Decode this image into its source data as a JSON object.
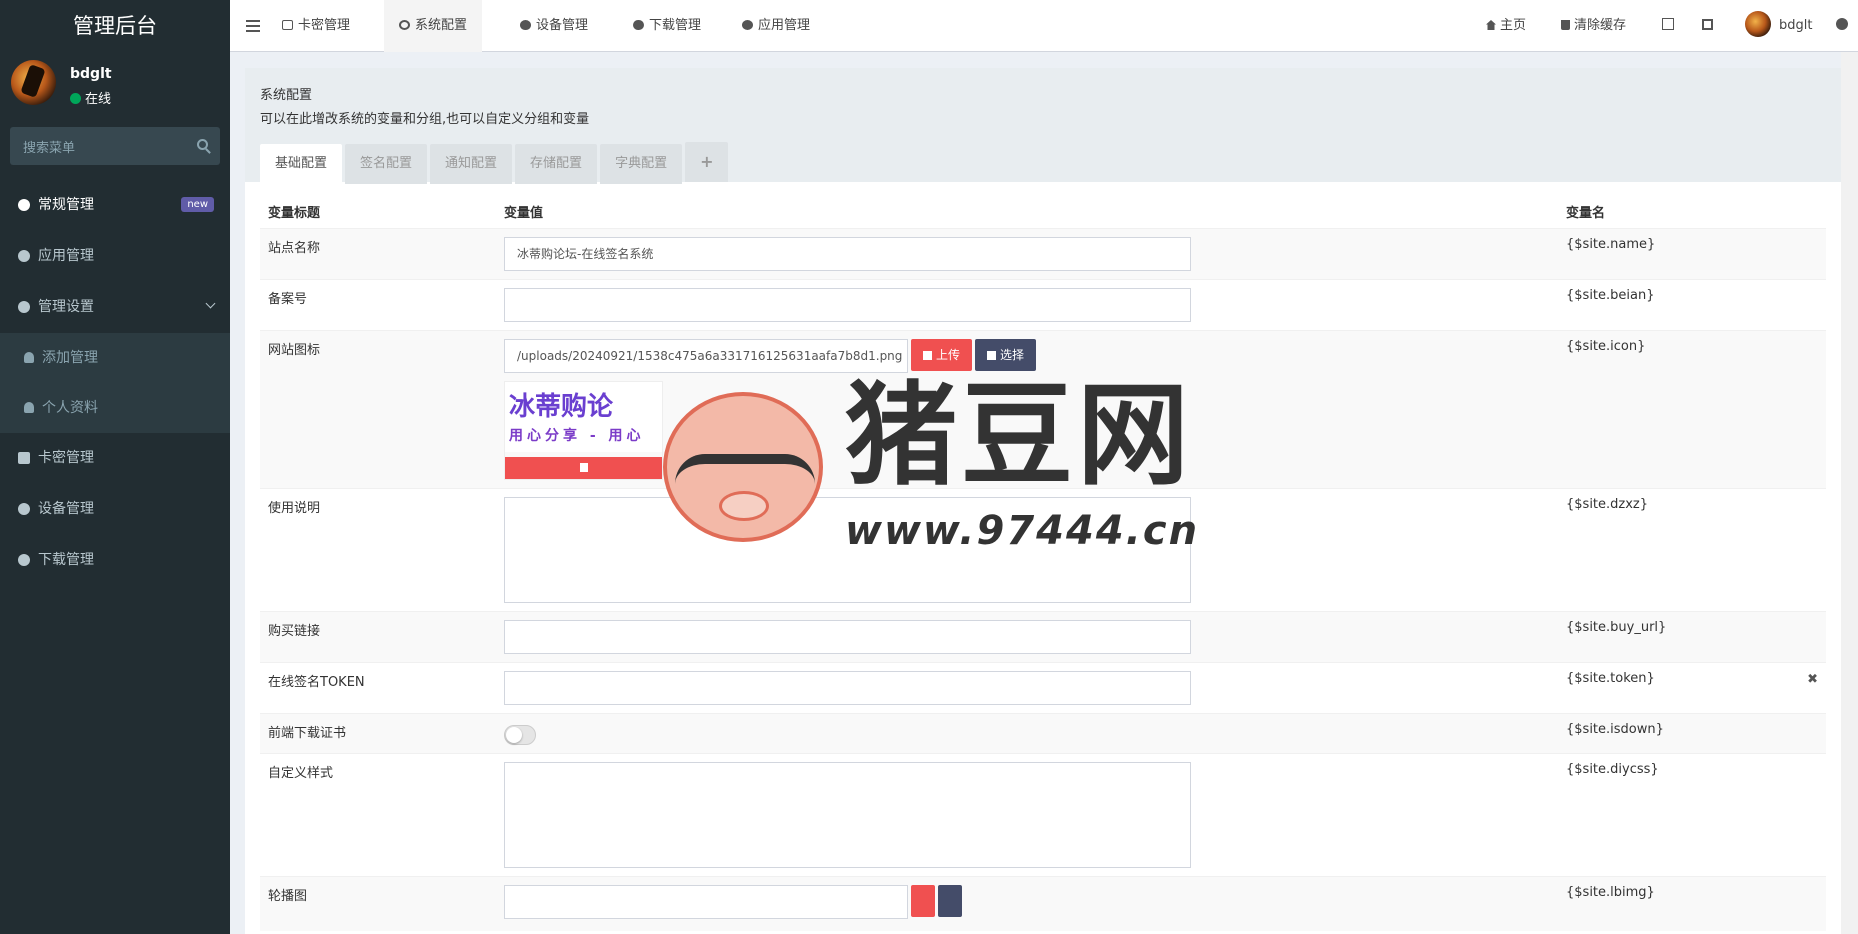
{
  "sidebar": {
    "logo": "管理后台",
    "user": {
      "name": "bdglt",
      "status": "在线"
    },
    "search_placeholder": "搜索菜单",
    "items": [
      {
        "label": "常规管理",
        "badge": "new"
      },
      {
        "label": "应用管理"
      },
      {
        "label": "管理设置"
      },
      {
        "label": "添加管理"
      },
      {
        "label": "个人资料"
      },
      {
        "label": "卡密管理"
      },
      {
        "label": "设备管理"
      },
      {
        "label": "下载管理"
      }
    ]
  },
  "header": {
    "tabs": [
      {
        "label": "卡密管理",
        "icon": "card-icon"
      },
      {
        "label": "系统配置",
        "icon": "gear-icon"
      },
      {
        "label": "设备管理",
        "icon": "apple-icon"
      },
      {
        "label": "下载管理",
        "icon": "cloud-download-icon"
      },
      {
        "label": "应用管理",
        "icon": "circle-icon"
      }
    ],
    "home": "主页",
    "clear_cache": "清除缓存",
    "username": "bdglt"
  },
  "panel": {
    "title": "系统配置",
    "desc": "可以在此增改系统的变量和分组,也可以自定义分组和变量",
    "tabs": [
      "基础配置",
      "签名配置",
      "通知配置",
      "存储配置",
      "字典配置"
    ],
    "plus": "+"
  },
  "table": {
    "headers": [
      "变量标题",
      "变量值",
      "变量名"
    ],
    "rows": [
      {
        "title": "站点名称",
        "value": "冰蒂购论坛-在线签名系统",
        "var": "{$site.name}"
      },
      {
        "title": "备案号",
        "value": "",
        "var": "{$site.beian}"
      },
      {
        "title": "网站图标",
        "value": "/uploads/20240921/1538c475a6a331716125631aafa7b8d1.png",
        "var": "{$site.icon}"
      },
      {
        "title": "使用说明",
        "value": "",
        "var": "{$site.dzxz}"
      },
      {
        "title": "购买链接",
        "value": "",
        "var": "{$site.buy_url}"
      },
      {
        "title": "在线签名TOKEN",
        "value": "",
        "var": "{$site.token}"
      },
      {
        "title": "前端下载证书",
        "value": "",
        "var": "{$site.isdown}"
      },
      {
        "title": "自定义样式",
        "value": "",
        "var": "{$site.diycss}"
      },
      {
        "title": "轮播图",
        "value": "",
        "var": "{$site.lbimg}"
      }
    ],
    "upload_label": "上传",
    "select_label": "选择",
    "thumb_text": "冰蒂购论",
    "thumb_sub": "用心分享 - 用心"
  },
  "watermark": {
    "title": "猪豆网",
    "url": "www.97444.cn"
  },
  "colors": {
    "sidebar": "#222d32",
    "accent_red": "#f05050",
    "dark_btn": "#444c69",
    "badge": "#605ca8",
    "online": "#00a65a"
  }
}
